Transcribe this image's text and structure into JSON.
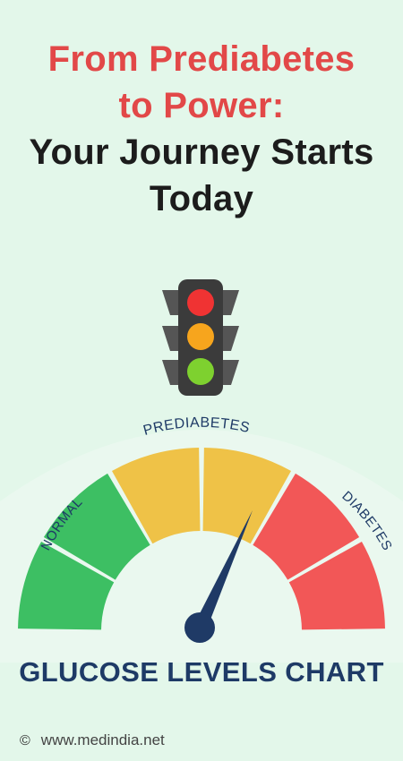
{
  "title": {
    "line1": "From Prediabetes",
    "line2": "to Power:",
    "line3": "Your Journey Starts",
    "line4": "Today"
  },
  "gauge": {
    "labels": {
      "normal": "NORMAL",
      "prediabetes": "PREDIABETES",
      "diabetes": "DIABETES"
    },
    "chart_label": "GLUCOSE LEVELS CHART",
    "colors": {
      "normal": "#3dbf63",
      "prediabetes": "#efc247",
      "diabetes": "#f25757",
      "needle": "#1f3a66",
      "label_text": "#1e3a66"
    }
  },
  "traffic_light": {
    "icon": "traffic-light-icon",
    "colors": {
      "red": "#f03333",
      "amber": "#f7a51d",
      "green": "#7ed12f",
      "housing": "#3b3b3b"
    }
  },
  "footer": {
    "icon": "copyright-icon",
    "site": "www.medindia.net"
  }
}
